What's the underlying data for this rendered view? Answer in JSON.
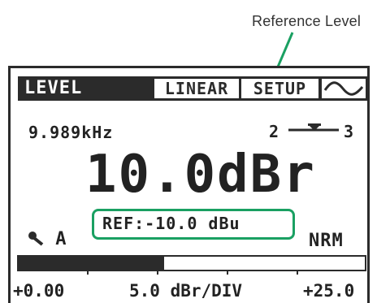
{
  "callout": {
    "label": "Reference Level"
  },
  "header": {
    "title": "LEVEL",
    "tabs": [
      "LINEAR",
      "SETUP"
    ],
    "wave_icon": "sine-wave-icon"
  },
  "readout": {
    "frequency": "9.989kHz",
    "channel_left": "2",
    "channel_right": "3",
    "channel_icon": "channel-link-icon",
    "value": "10.0dBr",
    "reference": "REF:-10.0 dBu",
    "probe": "A",
    "probe_icon": "probe-icon",
    "mode": "NRM"
  },
  "meter": {
    "fill_fraction": 0.42,
    "scale_min": "+0.00",
    "scale_div": "5.0 dBr/DIV",
    "scale_max": "+25.0"
  },
  "colors": {
    "accent": "#1aa062",
    "display_dark": "#2b2b2b"
  }
}
